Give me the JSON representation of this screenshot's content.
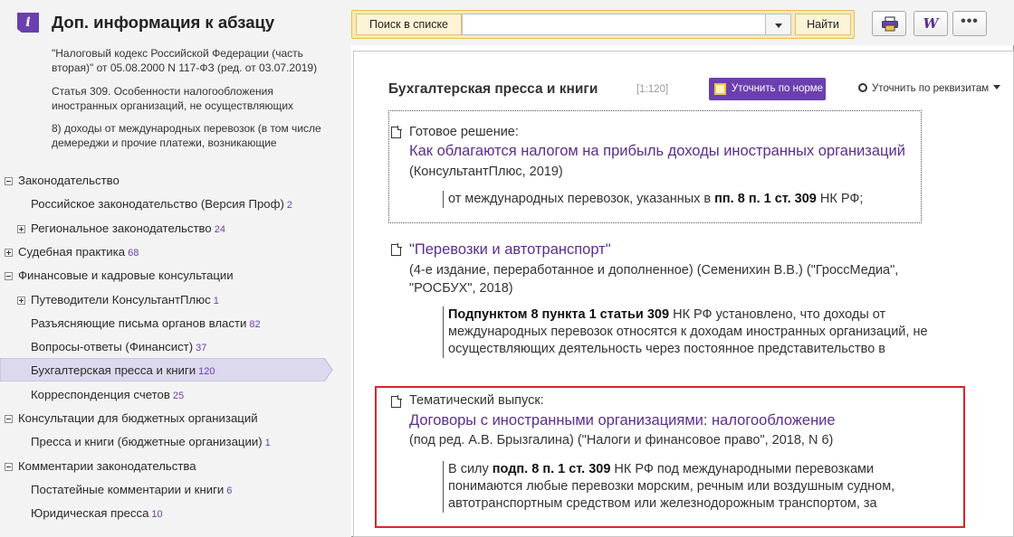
{
  "header": {
    "title": "Доп. информация к абзацу",
    "search": {
      "label": "Поиск в списке",
      "value": "",
      "placeholder": "",
      "button": "Найти"
    },
    "tools": [
      {
        "icon": "printer-icon"
      },
      {
        "icon": "word-icon",
        "glyph": "W"
      },
      {
        "icon": "more-icon",
        "glyph": "•••"
      }
    ]
  },
  "doc_info": {
    "law": "\"Налоговый кодекс Российской Федерации (часть вторая)\" от 05.08.2000 N 117-ФЗ (ред. от 03.07.2019)",
    "article": "Статья 309. Особенности налогообложения иностранных организаций, не осуществляющих",
    "paragraph": "8) доходы от международных перевозок (в том числе демереджи и прочие платежи, возникающие"
  },
  "tree": [
    {
      "label": "Законодательство",
      "count": "",
      "toggle": "minus",
      "level": 0
    },
    {
      "label": "Российское законодательство (Версия Проф)",
      "count": "2",
      "toggle": "",
      "level": 1
    },
    {
      "label": "Региональное законодательство",
      "count": "24",
      "toggle": "plus",
      "level": 1
    },
    {
      "label": "Судебная практика",
      "count": "68",
      "toggle": "plus",
      "level": 0
    },
    {
      "label": "Финансовые и кадровые консультации",
      "count": "",
      "toggle": "minus",
      "level": 0
    },
    {
      "label": "Путеводители КонсультантПлюс",
      "count": "1",
      "toggle": "plus",
      "level": 1
    },
    {
      "label": "Разъясняющие письма органов власти",
      "count": "82",
      "toggle": "",
      "level": 1
    },
    {
      "label": "Вопросы-ответы (Финансист)",
      "count": "37",
      "toggle": "",
      "level": 1
    },
    {
      "label": "Бухгалтерская пресса и книги",
      "count": "120",
      "toggle": "",
      "level": 1,
      "selected": true
    },
    {
      "label": "Корреспонденция счетов",
      "count": "25",
      "toggle": "",
      "level": 1
    },
    {
      "label": "Консультации для бюджетных организаций",
      "count": "",
      "toggle": "minus",
      "level": 0
    },
    {
      "label": "Пресса и книги (бюджетные организации)",
      "count": "1",
      "toggle": "",
      "level": 1
    },
    {
      "label": "Комментарии законодательства",
      "count": "",
      "toggle": "minus",
      "level": 0
    },
    {
      "label": "Постатейные комментарии и книги",
      "count": "6",
      "toggle": "",
      "level": 1
    },
    {
      "label": "Юридическая пресса",
      "count": "10",
      "toggle": "",
      "level": 1
    }
  ],
  "results": {
    "title": "Бухгалтерская пресса и книги",
    "count": "[1:120]",
    "refine_norm": "Уточнить по норме",
    "refine_requisites": "Уточнить по реквизитам",
    "items": [
      {
        "kind": "Готовое решение:",
        "link": "Как облагаются налогом на прибыль доходы иностранных организаций",
        "source": "(КонсультантПлюс, 2019)",
        "quote": [
          {
            "t": "от международных перевозок, указанных в "
          },
          {
            "t": "пп. 8 п. 1 ст. 309",
            "b": true
          },
          {
            "t": " НК РФ;"
          }
        ]
      },
      {
        "kind": "",
        "link": "\"Перевозки и автотранспорт\"",
        "source": "(4-е издание, переработанное и дополненное) (Семенихин В.В.) (\"ГроссМедиа\", \"РОСБУХ\", 2018)",
        "quote": [
          {
            "t": "Подпунктом 8 пункта 1 статьи 309",
            "b": true
          },
          {
            "t": " НК РФ установлено, что доходы от международных перевозок относятся к доходам иностранных организаций, не осуществляющих деятельность через постоянное представительство в"
          }
        ]
      },
      {
        "kind": "Тематический выпуск:",
        "link": "Договоры с иностранными организациями: налогообложение",
        "source": "(под ред. А.В. Брызгалина) (\"Налоги и финансовое право\", 2018, N 6)",
        "quote": [
          {
            "t": "В силу "
          },
          {
            "t": "подп. 8 п. 1 ст. 309",
            "b": true
          },
          {
            "t": " НК РФ под международными перевозками понимаются любые перевозки морским, речным или воздушным судном, автотранспортным средством или железнодорожным транспортом, за"
          }
        ]
      }
    ]
  },
  "colors": {
    "accent": "#6c3fb0",
    "link": "#5b2d91",
    "highlight_border": "#d8262d",
    "search_bg": "#fbe9b5"
  }
}
